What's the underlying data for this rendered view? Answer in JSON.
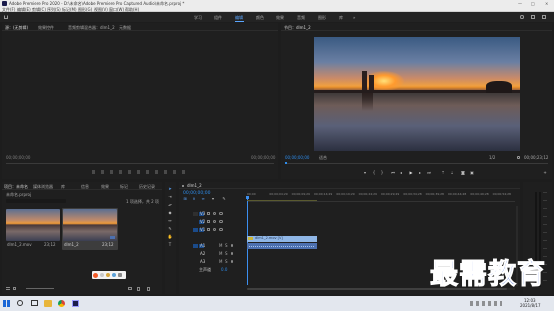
{
  "app": {
    "title": "Adobe Premiere Pro 2020 - D:\\未命名\\Adobe Premiere Pro Captured Audio\\未命名.prproj *",
    "window_controls": [
      "—",
      "□",
      "×"
    ]
  },
  "menubar": [
    "文件(F)",
    "编辑(E)",
    "剪辑(C)",
    "序列(S)",
    "标记(M)",
    "图形(G)",
    "视图(V)",
    "窗口(W)",
    "帮助(H)"
  ],
  "workspaces": {
    "items": [
      "学习",
      "组件",
      "编辑",
      "颜色",
      "效果",
      "音频",
      "图形",
      "库"
    ],
    "active_index": 2,
    "more": "»"
  },
  "source_panel": {
    "tabs": [
      "源：(无剪辑)",
      "效果控件",
      "音频剪辑混合器：dlm1_2",
      "元数据"
    ],
    "timecode_left": "00;00;00;00",
    "timecode_right": "00;00;00;00"
  },
  "program_panel": {
    "tab": "节目：dlm1_2",
    "timecode": "00;00;00;00",
    "fit": "适合",
    "scale": "1/2",
    "duration": "00;00;23;12"
  },
  "project_panel": {
    "tabs": [
      "项目：未命名",
      "媒体浏览器",
      "库",
      "信息",
      "效果",
      "标记",
      "历史记录"
    ],
    "search_placeholder": "",
    "project_file": "未命名.prproj",
    "item_count": "1 项选择，共 2 项",
    "clips": [
      {
        "name": "dlm1_2.mov",
        "duration": "23;12"
      },
      {
        "name": "dlm1_2",
        "duration": "23;12"
      }
    ]
  },
  "timeline": {
    "tab": "dlm1_2",
    "timecode": "00;00;00;00",
    "ruler": [
      "00;00",
      "00;00;04;29",
      "00;00;09;29",
      "00;00;14;29",
      "00;00;19;29",
      "00;00;24;29",
      "00;00;29;29",
      "00;00;34;28",
      "00;00;39;28",
      "00;00;44;28",
      "00;00;49;28",
      "00;00;54;28"
    ],
    "video_tracks": [
      "V3",
      "V2",
      "V1"
    ],
    "audio_tracks": [
      "A1",
      "A2",
      "A3"
    ],
    "master": "主声道",
    "master_value": "0.0",
    "clip_label": "dlm1_2.mov [V]"
  },
  "taskbar": {
    "time": "12:03",
    "date": "2021/8/17"
  },
  "watermark": "最需教育",
  "colors": {
    "accent": "#2d8ceb",
    "clip_blue": "#8fb6e6",
    "clip_label": "#4c70b0",
    "playhead": "#3c8ff0"
  }
}
